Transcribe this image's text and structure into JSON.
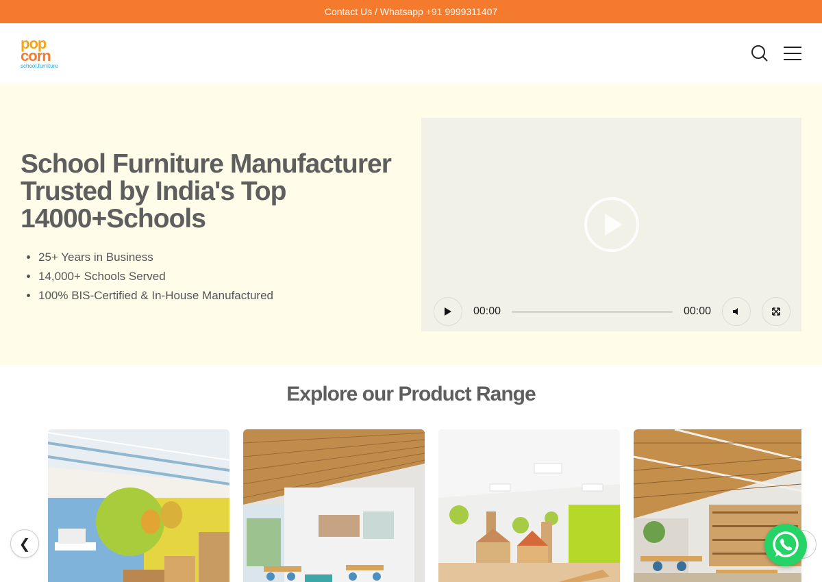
{
  "topbar": {
    "contact_text": "Contact Us / Whatsapp +91 9999311407"
  },
  "header": {
    "logo_pop": "pop",
    "logo_corn": "corn",
    "logo_sub": "school.furniture",
    "search_icon": "search-icon",
    "menu_icon": "hamburger-menu-icon"
  },
  "hero": {
    "title": "School Furniture Manufacturer Trusted by India's Top 14000+Schools",
    "bullets": [
      "25+ Years in Business",
      "14,000+ Schools Served",
      "100% BIS-Certified & In-House Manufactured"
    ]
  },
  "video": {
    "current_time": "00:00",
    "duration": "00:00",
    "progress": 0
  },
  "products": {
    "title": "Explore our Product Range",
    "prev_label": "❮",
    "cards": [
      {
        "image": "classroom-blue-yellow"
      },
      {
        "image": "classroom-brick-wall"
      },
      {
        "image": "playroom-green"
      },
      {
        "image": "library-wood-ceiling"
      }
    ]
  },
  "colors": {
    "accent": "#f47a2e",
    "hero_bg": "#fffde9",
    "whatsapp": "#25d366"
  }
}
